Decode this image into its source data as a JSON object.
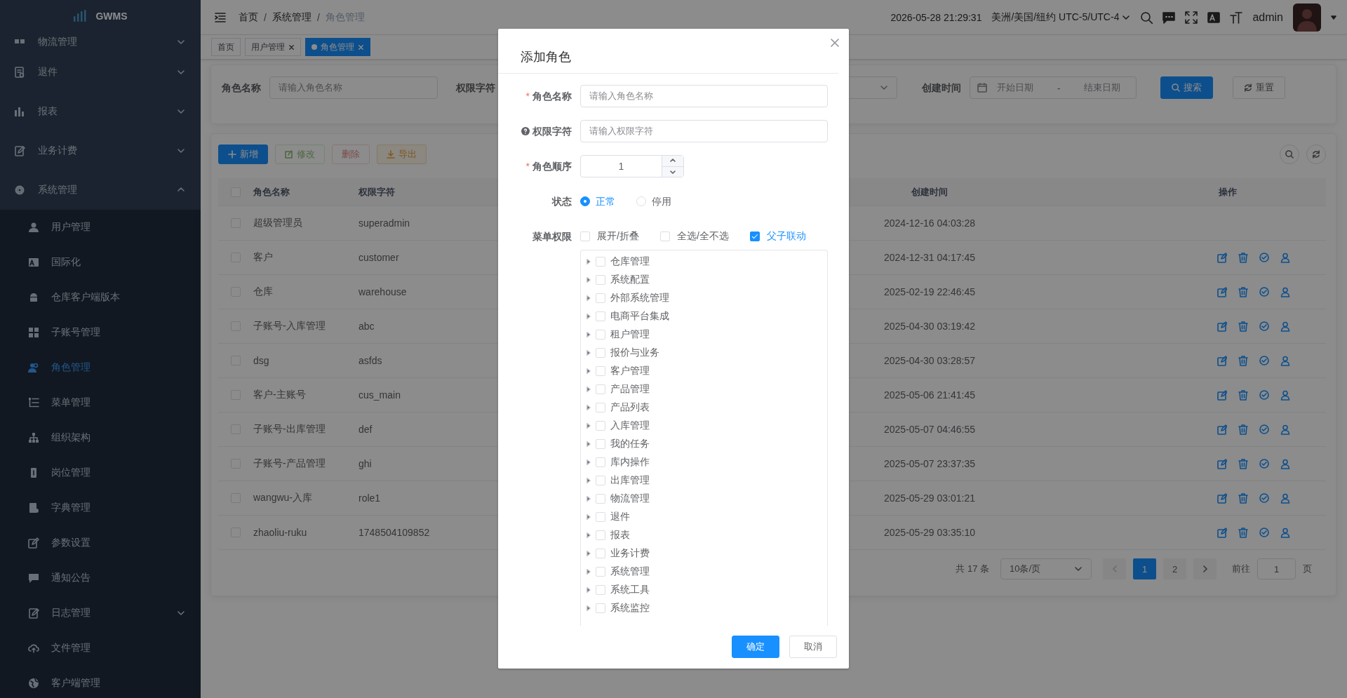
{
  "sidebar": {
    "logo": "GWMS",
    "items": [
      {
        "label": "物流管理",
        "expanded": false
      },
      {
        "label": "退件",
        "expanded": false
      },
      {
        "label": "报表",
        "expanded": false
      },
      {
        "label": "业务计费",
        "expanded": false
      },
      {
        "label": "系统管理",
        "expanded": true,
        "children": [
          {
            "label": "用户管理",
            "selected": false
          },
          {
            "label": "国际化",
            "selected": false
          },
          {
            "label": "仓库客户端版本",
            "selected": false
          },
          {
            "label": "子账号管理",
            "selected": false
          },
          {
            "label": "角色管理",
            "selected": true
          },
          {
            "label": "菜单管理",
            "selected": false
          },
          {
            "label": "组织架构",
            "selected": false
          },
          {
            "label": "岗位管理",
            "selected": false
          },
          {
            "label": "字典管理",
            "selected": false
          },
          {
            "label": "参数设置",
            "selected": false
          },
          {
            "label": "通知公告",
            "selected": false
          },
          {
            "label": "日志管理",
            "selected": false,
            "expanded": false
          },
          {
            "label": "文件管理",
            "selected": false
          },
          {
            "label": "客户端管理",
            "selected": false
          }
        ]
      }
    ]
  },
  "header": {
    "breadcrumb": [
      "首页",
      "系统管理",
      "角色管理"
    ],
    "breadcrumb_separator": "/",
    "datetime": "2026-05-28 21:29:31",
    "timezone": "美洲/美国/纽约 UTC-5/UTC-4",
    "user": "admin"
  },
  "tabs": [
    {
      "label": "首页",
      "selected": false,
      "closable": false
    },
    {
      "label": "用户管理",
      "selected": false,
      "closable": true
    },
    {
      "label": "角色管理",
      "selected": true,
      "closable": true
    }
  ],
  "filters": {
    "role_name": {
      "label": "角色名称",
      "placeholder": "请输入角色名称"
    },
    "permission_label": "权限字符",
    "created": {
      "label": "创建时间",
      "start_placeholder": "开始日期",
      "separator": "-",
      "end_placeholder": "结束日期"
    },
    "buttons": [
      {
        "label": "搜索",
        "kind": "primary"
      },
      {
        "label": "重置",
        "kind": "default"
      }
    ]
  },
  "toolbar": [
    {
      "label": "新增",
      "kind": "primary",
      "disabled": false
    },
    {
      "label": "修改",
      "kind": "success",
      "disabled": true
    },
    {
      "label": "删除",
      "kind": "danger",
      "disabled": true
    },
    {
      "label": "导出",
      "kind": "warning",
      "disabled": false
    }
  ],
  "table": {
    "all_checked": false,
    "columns": [
      "角色名称",
      "权限字符",
      "创建时间",
      "操作"
    ],
    "rows": [
      {
        "checked": false,
        "name": "超级管理员",
        "key": "superadmin",
        "created": "2024-12-16 04:03:28",
        "actions": false
      },
      {
        "checked": false,
        "name": "客户",
        "key": "customer",
        "created": "2024-12-31 04:17:45",
        "actions": true
      },
      {
        "checked": false,
        "name": "仓库",
        "key": "warehouse",
        "created": "2025-02-19 22:46:45",
        "actions": true
      },
      {
        "checked": false,
        "name": "子账号-入库管理",
        "key": "abc",
        "created": "2025-04-30 03:19:42",
        "actions": true
      },
      {
        "checked": false,
        "name": "dsg",
        "key": "asfds",
        "created": "2025-04-30 03:28:57",
        "actions": true
      },
      {
        "checked": false,
        "name": "客户-主账号",
        "key": "cus_main",
        "created": "2025-05-06 21:41:45",
        "actions": true
      },
      {
        "checked": false,
        "name": "子账号-出库管理",
        "key": "def",
        "created": "2025-05-07 04:46:55",
        "actions": true
      },
      {
        "checked": false,
        "name": "子账号-产品管理",
        "key": "ghi",
        "created": "2025-05-07 23:37:35",
        "actions": true
      },
      {
        "checked": false,
        "name": "wangwu-入库",
        "key": "role1",
        "created": "2025-05-29 03:01:21",
        "actions": true
      },
      {
        "checked": false,
        "name": "zhaoliu-ruku",
        "key": "1748504109852",
        "created": "2025-05-29 03:35:10",
        "actions": true
      }
    ]
  },
  "pagination": {
    "total": "共 17 条",
    "page_size": "10条/页",
    "pages": [
      {
        "label": "1",
        "selected": true
      },
      {
        "label": "2",
        "selected": false
      }
    ],
    "goto_label": "前往",
    "goto_value": "1",
    "suffix": "页"
  },
  "dialog": {
    "title": "添加角色",
    "required_mark": "*",
    "fields": [
      {
        "kind": "text",
        "required": true,
        "label": "角色名称",
        "placeholder": "请输入角色名称"
      },
      {
        "kind": "text",
        "help": true,
        "label": "权限字符",
        "placeholder": "请输入权限字符"
      },
      {
        "kind": "number",
        "required": true,
        "label": "角色顺序",
        "value": "1"
      },
      {
        "kind": "radio",
        "label": "状态",
        "options": [
          {
            "label": "正常",
            "selected": true
          },
          {
            "label": "停用",
            "selected": false
          }
        ]
      },
      {
        "kind": "tree",
        "label": "菜单权限",
        "options": [
          {
            "label": "展开/折叠",
            "checked": false
          },
          {
            "label": "全选/全不选",
            "checked": false
          },
          {
            "label": "父子联动",
            "checked": true
          }
        ],
        "nodes": [
          {
            "label": "仓库管理",
            "checked": false
          },
          {
            "label": "系统配置",
            "checked": false
          },
          {
            "label": "外部系统管理",
            "checked": false
          },
          {
            "label": "电商平台集成",
            "checked": false
          },
          {
            "label": "租户管理",
            "checked": false
          },
          {
            "label": "报价与业务",
            "checked": false
          },
          {
            "label": "客户管理",
            "checked": false
          },
          {
            "label": "产品管理",
            "checked": false
          },
          {
            "label": "产品列表",
            "checked": false
          },
          {
            "label": "入库管理",
            "checked": false
          },
          {
            "label": "我的任务",
            "checked": false
          },
          {
            "label": "库内操作",
            "checked": false
          },
          {
            "label": "出库管理",
            "checked": false
          },
          {
            "label": "物流管理",
            "checked": false
          },
          {
            "label": "退件",
            "checked": false
          },
          {
            "label": "报表",
            "checked": false
          },
          {
            "label": "业务计费",
            "checked": false
          },
          {
            "label": "系统管理",
            "checked": false
          },
          {
            "label": "系统工具",
            "checked": false
          },
          {
            "label": "系统监控",
            "checked": false
          }
        ]
      }
    ],
    "buttons": [
      {
        "label": "确定",
        "kind": "primary"
      },
      {
        "label": "取消",
        "kind": "default"
      }
    ]
  }
}
